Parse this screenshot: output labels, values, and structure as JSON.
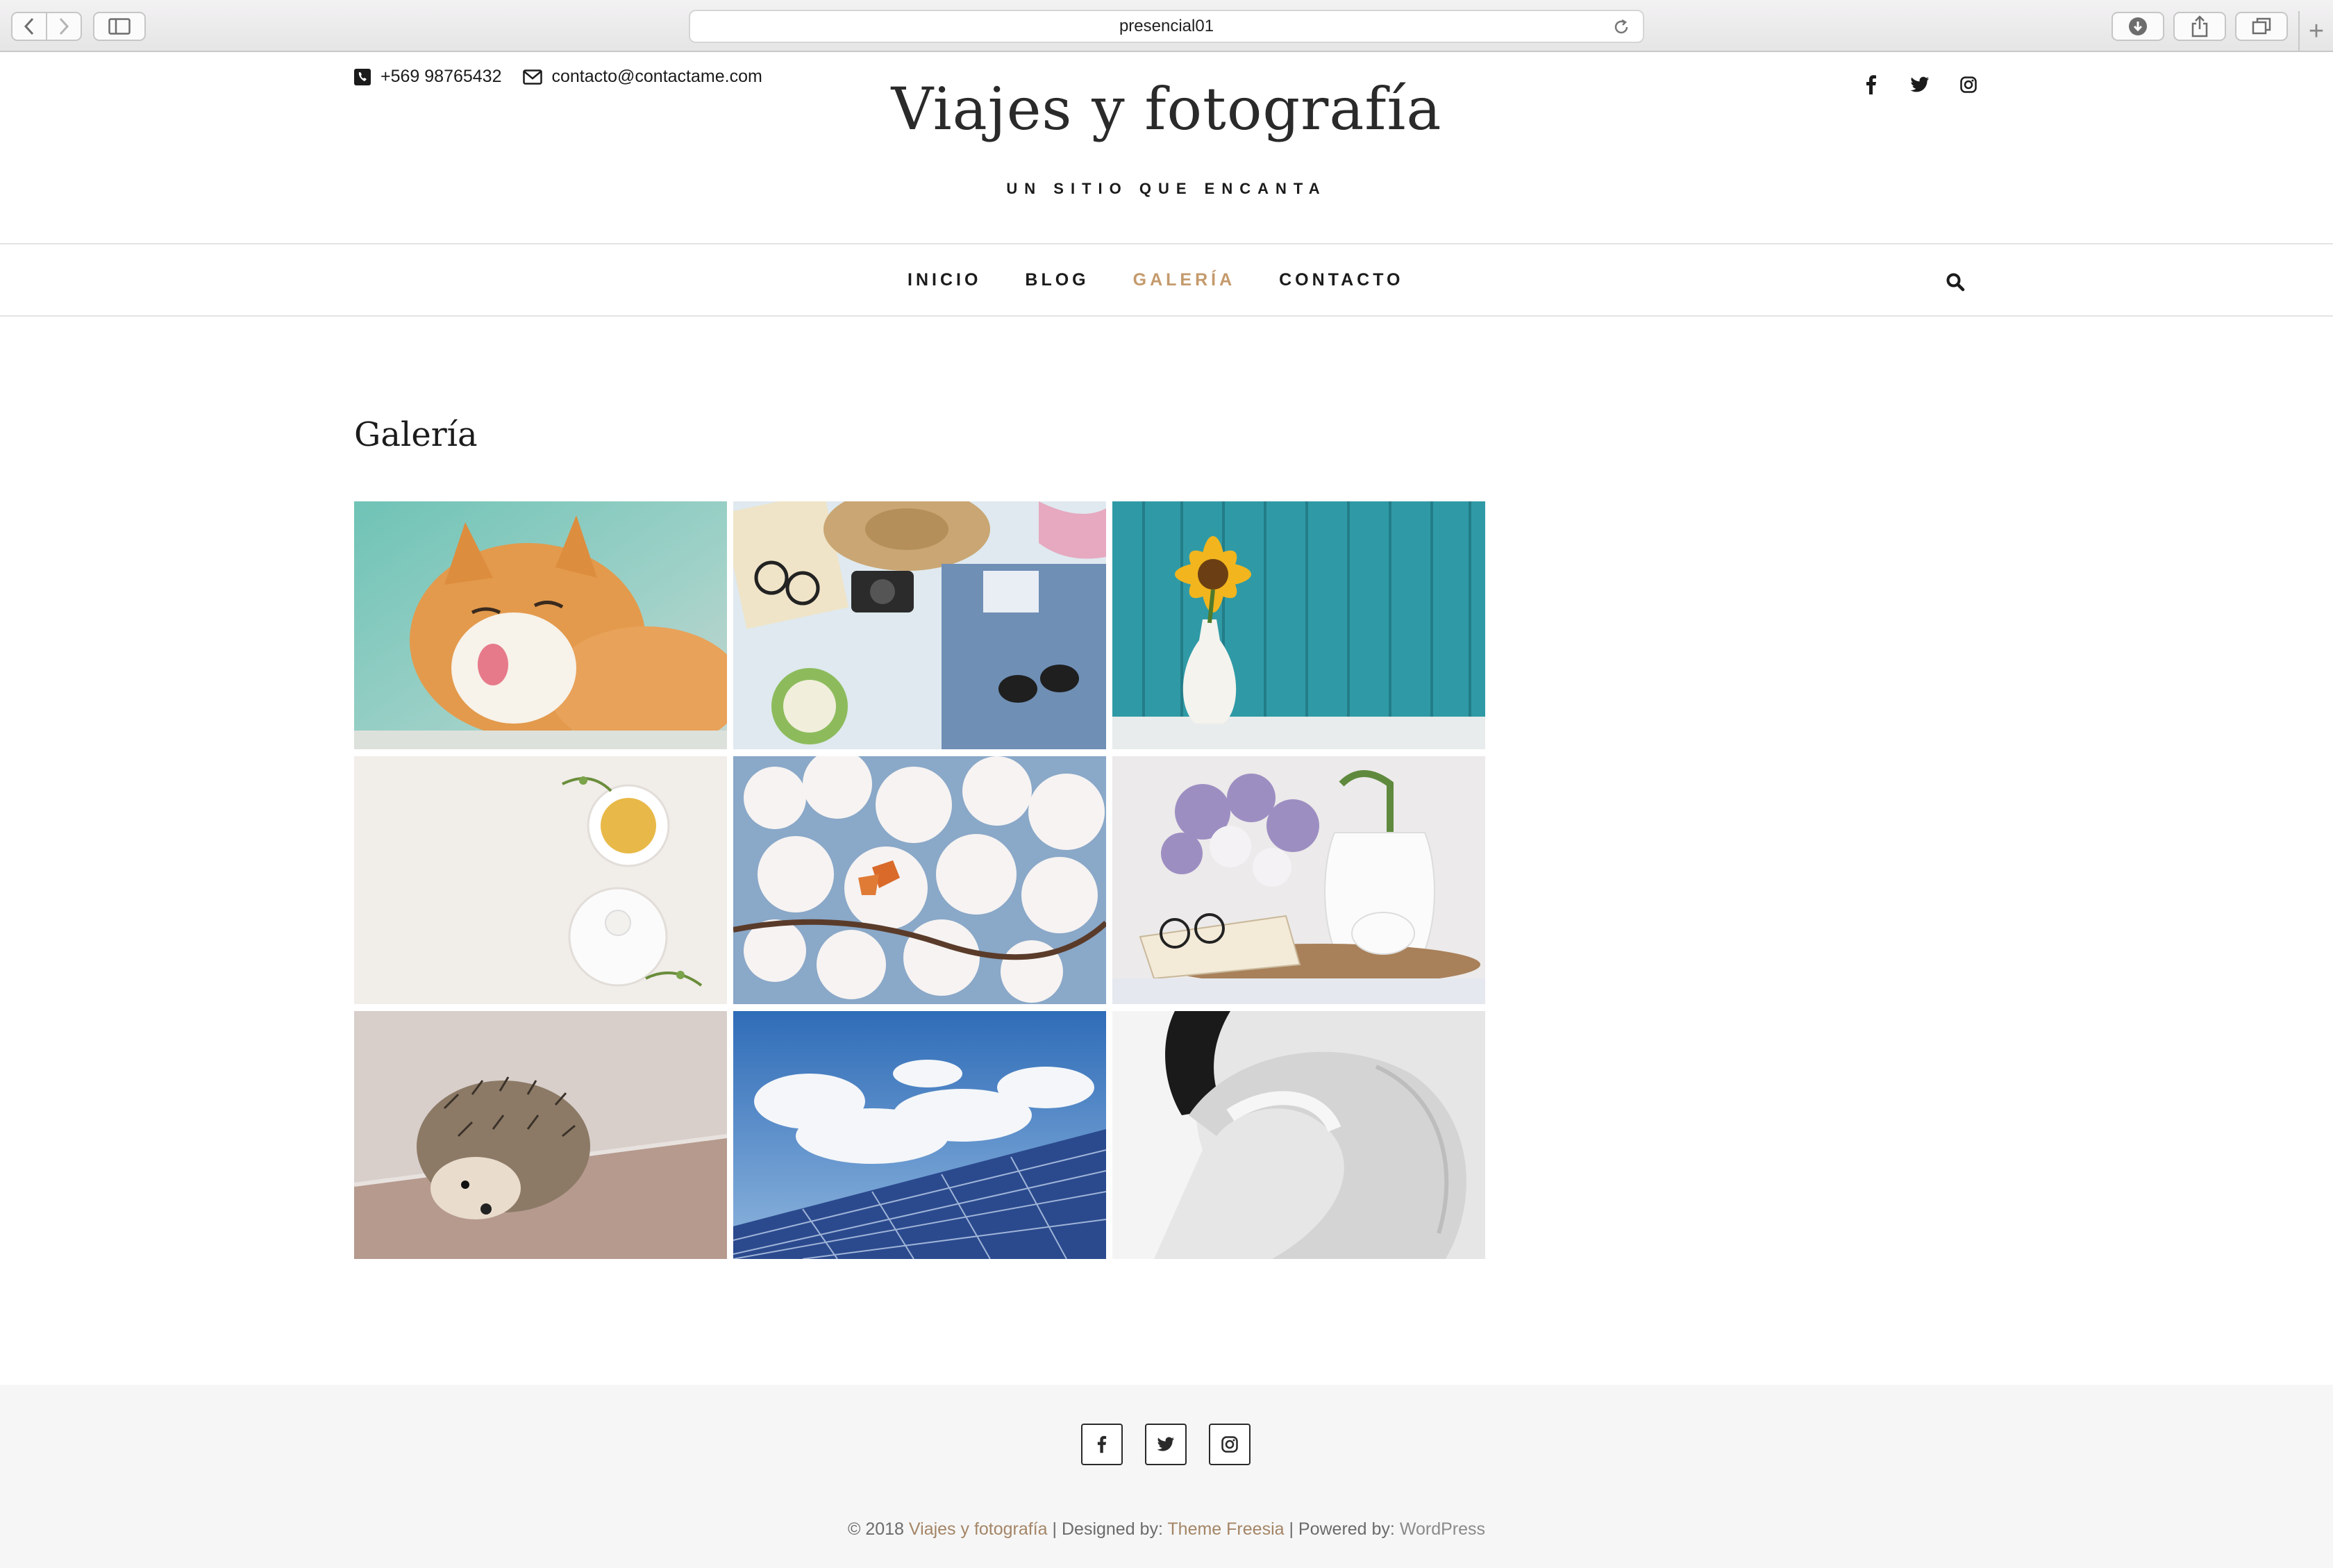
{
  "browser": {
    "url": "presencial01"
  },
  "header": {
    "phone": "+569 98765432",
    "email": "contacto@contactame.com",
    "site_title": "Viajes y fotografía",
    "tagline": "UN SITIO QUE ENCANTA"
  },
  "nav": {
    "items": [
      {
        "label": "INICIO"
      },
      {
        "label": "BLOG"
      },
      {
        "label": "GALERÍA"
      },
      {
        "label": "CONTACTO"
      }
    ]
  },
  "page": {
    "heading": "Galería"
  },
  "gallery": {
    "images": [
      {
        "subject": "cat"
      },
      {
        "subject": "travel-flatlay"
      },
      {
        "subject": "sunflower-vase"
      },
      {
        "subject": "tea-set"
      },
      {
        "subject": "cherry-blossom-butterfly"
      },
      {
        "subject": "lilacs-book-tea"
      },
      {
        "subject": "hedgehog"
      },
      {
        "subject": "solar-panel-sky"
      },
      {
        "subject": "swan"
      }
    ]
  },
  "footer": {
    "copyright_prefix": "© 2018 ",
    "site_link": "Viajes y fotografía",
    "designed_by_label": " | Designed by: ",
    "designer_link": "Theme Freesia",
    "powered_by_label": " | Powered by: ",
    "powered_link": "WordPress"
  },
  "colors": {
    "accent": "#c49a6c",
    "text": "#1b1b1b",
    "footer_bg": "#f6f6f6"
  }
}
